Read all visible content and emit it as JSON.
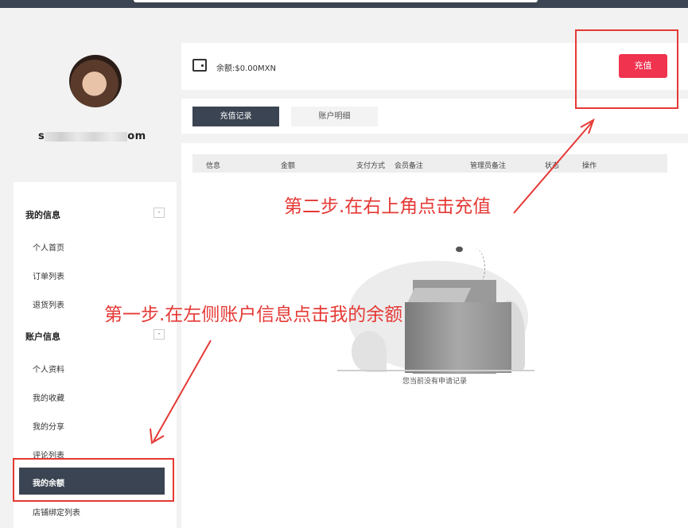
{
  "profile": {
    "username_start": "s",
    "username_end": "om"
  },
  "sidebar": {
    "sections": [
      {
        "title": "我的信息",
        "toggle": "-",
        "items": [
          "个人首页",
          "订单列表",
          "退货列表"
        ]
      },
      {
        "title": "账户信息",
        "toggle": "-",
        "items": [
          "个人资料",
          "我的收藏",
          "我的分享",
          "评论列表",
          "我的余额",
          "店铺绑定列表"
        ]
      }
    ],
    "active_item": "我的余额"
  },
  "balance": {
    "label": "余额:$0.00MXN",
    "recharge_button": "充值"
  },
  "tabs": [
    "充值记录",
    "账户明细"
  ],
  "table": {
    "columns": [
      "信息",
      "金额",
      "支付方式",
      "会员备注",
      "管理员备注",
      "状态",
      "操作"
    ],
    "empty_text": "您当前没有申请记录"
  },
  "annotations": {
    "step1": "第一步.在左侧账户信息点击我的余额",
    "step2": "第二步.在右上角点击充值"
  },
  "colors": {
    "primary_dark": "#3b4452",
    "accent_red": "#f0334f",
    "annotation_red": "#e53935"
  }
}
